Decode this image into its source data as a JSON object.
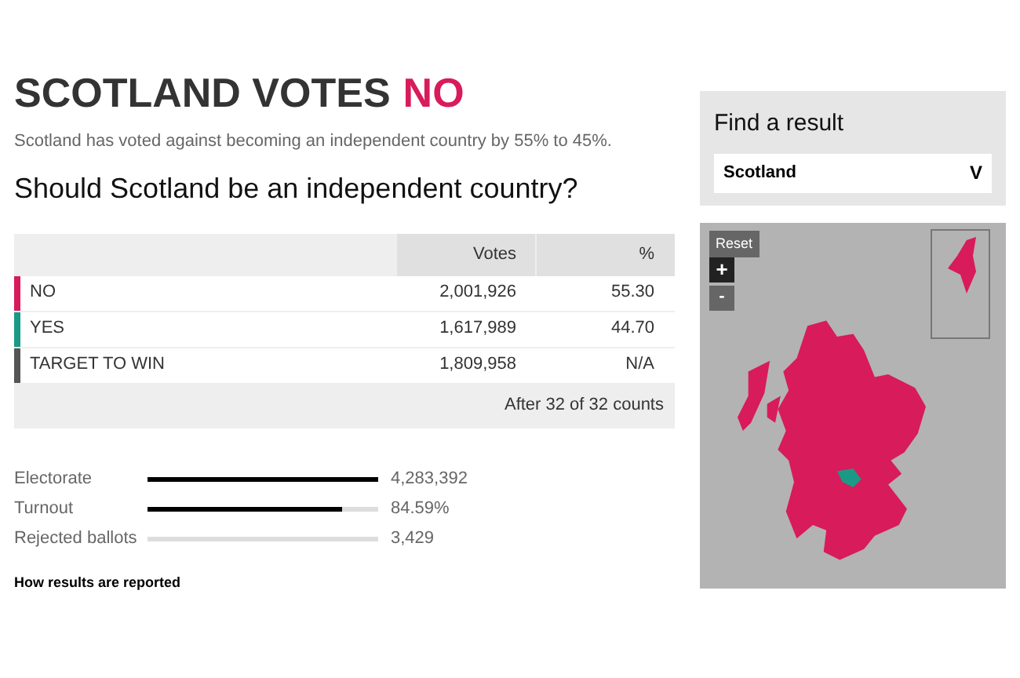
{
  "headline": {
    "text": "SCOTLAND VOTES",
    "result": "NO"
  },
  "summary": "Scotland has voted against becoming an independent country by 55% to 45%.",
  "question": "Should Scotland be an independent country?",
  "table": {
    "columns": [
      "Votes",
      "%"
    ],
    "rows": [
      {
        "label": "NO",
        "votes": "2,001,926",
        "percent": "55.30",
        "color": "#d81b5a"
      },
      {
        "label": "YES",
        "votes": "1,617,989",
        "percent": "44.70",
        "color": "#1a9a86"
      },
      {
        "label": "TARGET TO WIN",
        "votes": "1,809,958",
        "percent": "N/A",
        "color": "#555555"
      }
    ],
    "footer": "After 32 of 32 counts"
  },
  "stats": [
    {
      "label": "Electorate",
      "level": 1,
      "reading": "4,283,392"
    },
    {
      "label": "Turnout",
      "level": 0.8459,
      "reading": "84.59%"
    },
    {
      "label": "Rejected ballots",
      "level": 0,
      "reading": "3,429"
    }
  ],
  "link": "How results are reported",
  "finder": {
    "title": "Find a result",
    "value": "Scotland",
    "caret": "V"
  },
  "map": {
    "reset": "Reset",
    "zoom_in": "+",
    "zoom_out": "-"
  }
}
